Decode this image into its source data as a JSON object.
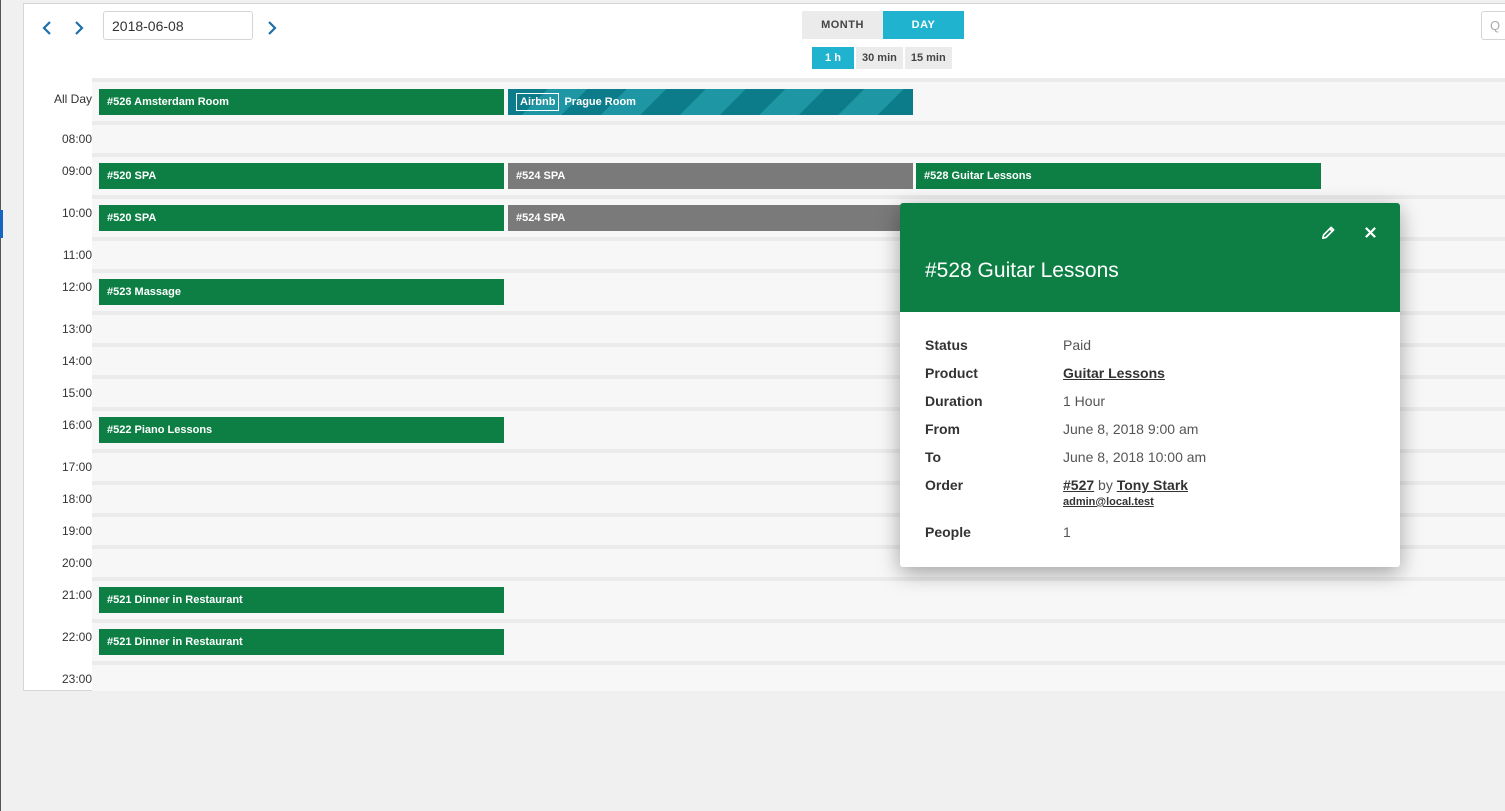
{
  "toolbar": {
    "date_value": "2018-06-08",
    "view_month": "MONTH",
    "view_day": "DAY",
    "slot_1h": "1 h",
    "slot_30": "30 min",
    "slot_15": "15 min",
    "search_placeholder": "Q"
  },
  "times": {
    "allday": "All Day",
    "t08": "08:00",
    "t09": "09:00",
    "t10": "10:00",
    "t11": "11:00",
    "t12": "12:00",
    "t13": "13:00",
    "t14": "14:00",
    "t15": "15:00",
    "t16": "16:00",
    "t17": "17:00",
    "t18": "18:00",
    "t19": "19:00",
    "t20": "20:00",
    "t21": "21:00",
    "t22": "22:00",
    "t23": "23:00"
  },
  "events": {
    "e526": "#526 Amsterdam Room",
    "airbnb_tag": "Airbnb",
    "airbnb_prague": "Prague Room",
    "e520_9": "#520 SPA",
    "e524_9": "#524 SPA",
    "e528": "#528 Guitar Lessons",
    "e520_10": "#520 SPA",
    "e524_10": "#524 SPA",
    "e523": "#523 Massage",
    "e522": "#522 Piano Lessons",
    "e521_21": "#521 Dinner in Restaurant",
    "e521_22": "#521 Dinner in Restaurant"
  },
  "popover": {
    "title": "#528 Guitar Lessons",
    "status_label": "Status",
    "status_value": "Paid",
    "product_label": "Product",
    "product_value": "Guitar Lessons",
    "duration_label": "Duration",
    "duration_value": "1 Hour",
    "from_label": "From",
    "from_value": "June 8, 2018 9:00 am",
    "to_label": "To",
    "to_value": "June 8, 2018 10:00 am",
    "order_label": "Order",
    "order_number": "#527",
    "order_by": "by",
    "order_customer": "Tony Stark",
    "order_email": "admin@local.test",
    "people_label": "People",
    "people_value": "1"
  },
  "colors": {
    "booking_green": "#0d7f45",
    "booking_grey": "#7a7a7a",
    "accent_cyan": "#1fb3cf",
    "airbnb_teal": "#0c7c8a"
  }
}
